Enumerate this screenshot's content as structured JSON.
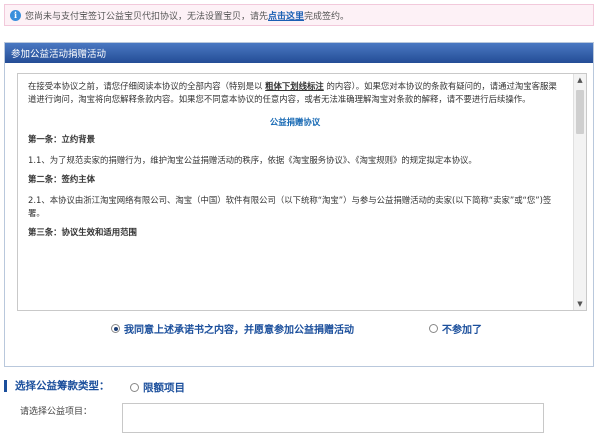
{
  "notice": {
    "text_before": "您尚未与支付宝签订公益宝贝代扣协议，无法设置宝贝，请先",
    "link": "点击这里",
    "text_after": "完成签约。"
  },
  "panel": {
    "title": "参加公益活动捐赠活动"
  },
  "agreement": {
    "intro_1": "在接受本协议之前，请您仔细阅读本协议的全部内容（特别是以",
    "intro_bold": "粗体下划线标注",
    "intro_2": "的内容）。如果您对本协议的条款有疑问的，请通过淘宝客服渠道进行询问，淘宝将向您解释条款内容。如果您不同意本协议的任意内容，或者无法准确理解淘宝对条款的解释，请不要进行后续操作。",
    "contract_title": "公益捐赠协议",
    "sections": [
      {
        "heading": "第一条：立约背景",
        "text": "1.1、为了规范卖家的捐赠行为，维护淘宝公益捐赠活动的秩序，依据《淘宝服务协议》、《淘宝规则》的规定拟定本协议。"
      },
      {
        "heading": "第二条：签约主体",
        "text": "2.1、本协议由浙江淘宝网络有限公司、淘宝（中国）软件有限公司（以下统称“淘宝”）与参与公益捐赠活动的卖家(以下简称“卖家”或“您”)签署。"
      },
      {
        "heading": "第三条：协议生效和适用范围",
        "text": ""
      }
    ]
  },
  "choices": {
    "agree": "我同意上述承诺书之内容，并愿意参加公益捐赠活动",
    "disagree": "不参加了"
  },
  "donation": {
    "type_label": "选择公益筹款类型：",
    "limited_option": "限额项目",
    "project_label": "请选择公益项目："
  }
}
